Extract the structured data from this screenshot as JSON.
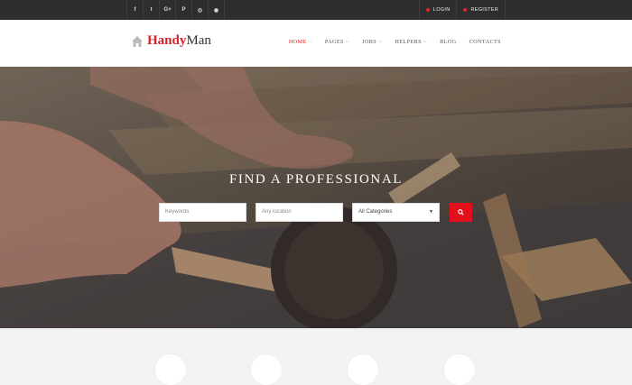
{
  "topbar": {
    "social": [
      {
        "label": "f",
        "icon": "facebook-icon"
      },
      {
        "label": "t",
        "icon": "twitter-icon"
      },
      {
        "label": "G+",
        "icon": "google-plus-icon"
      },
      {
        "label": "P",
        "icon": "pinterest-icon"
      },
      {
        "label": "◎",
        "icon": "instagram-icon"
      },
      {
        "label": "◉",
        "icon": "rss-icon"
      }
    ],
    "login": "LOGIN",
    "register": "REGISTER"
  },
  "header": {
    "logo_part1": "Handy",
    "logo_part2": "Man",
    "nav": [
      {
        "label": "HOME",
        "has_dropdown": true,
        "active": true
      },
      {
        "label": "PAGES",
        "has_dropdown": true
      },
      {
        "label": "JOBS",
        "has_dropdown": true
      },
      {
        "label": "HELPERS",
        "has_dropdown": true
      },
      {
        "label": "BLOG",
        "has_dropdown": false
      },
      {
        "label": "CONTACTS",
        "has_dropdown": false
      }
    ]
  },
  "hero": {
    "title": "FIND A PROFESSIONAL",
    "keywords_placeholder": "Keywords",
    "location_placeholder": "Any location",
    "category_value": "All Categories",
    "dropdown_caret": "▼"
  },
  "colors": {
    "accent": "#d82229",
    "topbar": "#2e2e31",
    "search_button": "#e3101c"
  }
}
